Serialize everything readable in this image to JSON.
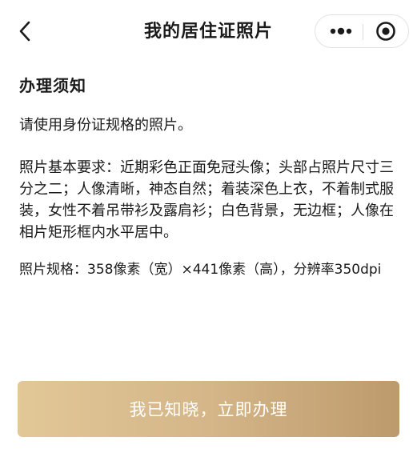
{
  "nav": {
    "title": "我的居住证照片"
  },
  "content": {
    "heading": "办理须知",
    "intro": "请使用身份证规格的照片。",
    "requirements": "照片基本要求：近期彩色正面免冠头像；头部占照片尺寸三分之二；人像清晰，神态自然；着装深色上衣，不着制式服装，女性不着吊带衫及露肩衫；白色背景，无边框；人像在相片矩形框内水平居中。",
    "spec": "照片规格：358像素（宽）×441像素（高），分辨率350dpi"
  },
  "action": {
    "confirm_label": "我已知晓，立即办理"
  },
  "colors": {
    "button_gradient_start": "#e2c797",
    "button_gradient_end": "#bd9a6c",
    "button_text": "#ffffff"
  }
}
